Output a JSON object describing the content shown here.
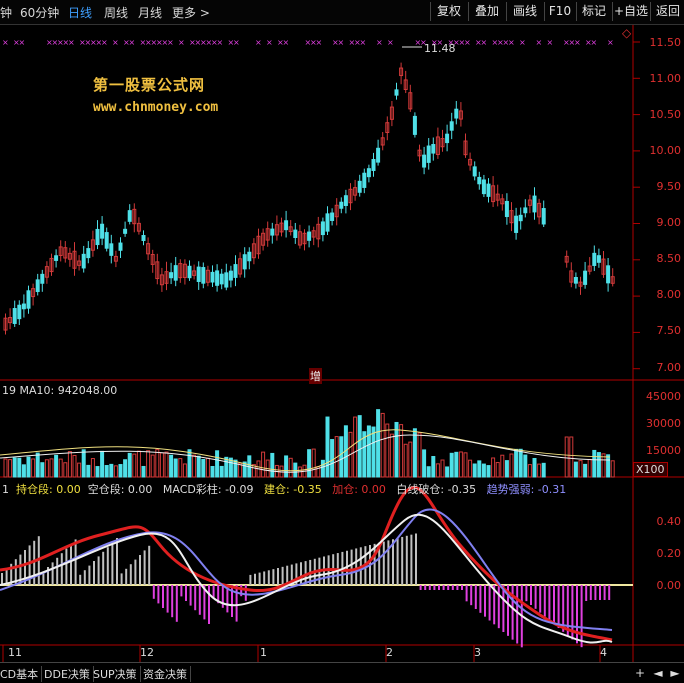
{
  "toolbar": {
    "tabs": [
      "钟",
      "60分钟",
      "日线",
      "周线",
      "月线",
      "更多 >"
    ],
    "active_tab": "日线",
    "buttons": [
      "复权",
      "叠加",
      "画线",
      "F10",
      "标记",
      "+自选",
      "返回"
    ]
  },
  "watermark": {
    "line1": "第一股票公式网",
    "line2": "www.chnmoney.com"
  },
  "price_panel": {
    "high_marker": "11.48",
    "y_ticks": [
      "11.50",
      "11.00",
      "10.50",
      "10.00",
      "9.50",
      "9.00",
      "8.50",
      "8.00",
      "7.50",
      "7.00"
    ],
    "signal_label": "增"
  },
  "volume_panel": {
    "info": "19 MA10: 942048.00",
    "y_ticks": [
      "45000",
      "30000",
      "15000"
    ],
    "unit_badge": "X100"
  },
  "macd_panel": {
    "items": [
      {
        "label": "1",
        "color": "#dddddd"
      },
      {
        "label": "持仓段: 0.00",
        "color": "#f0e040"
      },
      {
        "label": "空仓段: 0.00",
        "color": "#dddddd"
      },
      {
        "label": "MACD彩柱: -0.09",
        "color": "#dddddd"
      },
      {
        "label": "建仓: -0.35",
        "color": "#f0e040"
      },
      {
        "label": "加仓: 0.00",
        "color": "#e03030"
      },
      {
        "label": "白线破仓: -0.35",
        "color": "#dddddd"
      },
      {
        "label": "趋势强弱: -0.31",
        "color": "#8f8fff"
      }
    ],
    "y_ticks": [
      "0.40",
      "0.20",
      "0.00"
    ]
  },
  "x_axis": {
    "labels": [
      "11",
      "12",
      "1",
      "2",
      "3",
      "4"
    ]
  },
  "bottom_tabs": [
    "CD基本",
    "DDE决策",
    "SUP决策",
    "资金决策"
  ],
  "bottom_icons": [
    "+",
    "◄",
    "►"
  ],
  "colors": {
    "up": "#d23a3a",
    "down": "#4fe0e8",
    "axis": "#b00000",
    "macd_pos": "#c0c0c0",
    "macd_neg": "#e040e0"
  }
}
